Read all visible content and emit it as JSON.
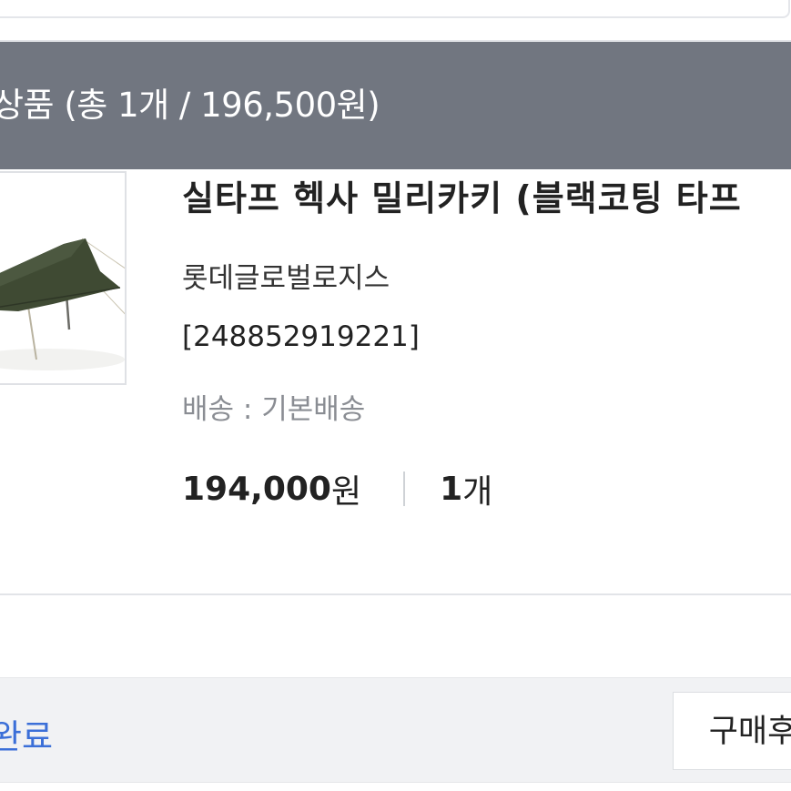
{
  "order_summary": {
    "header_text": "상품 (총 1개 / 196,500원)"
  },
  "product": {
    "title": "실타프 헥사 밀리카키 (블랙코팅 타프",
    "seller": "롯데글로벌로지스",
    "order_number": "[248852919221]",
    "shipping": "배송 : 기본배송",
    "price": "194,000",
    "price_unit": "원",
    "quantity": "1",
    "quantity_unit": "개",
    "thumbnail_icon": "tarp-product-image"
  },
  "footer": {
    "status": "완료",
    "review_button": "구매후"
  },
  "colors": {
    "header_bg": "#717680",
    "status_blue": "#3b6fd8",
    "footer_bg": "#f1f2f4",
    "tarp_green": "#3f4a33"
  }
}
